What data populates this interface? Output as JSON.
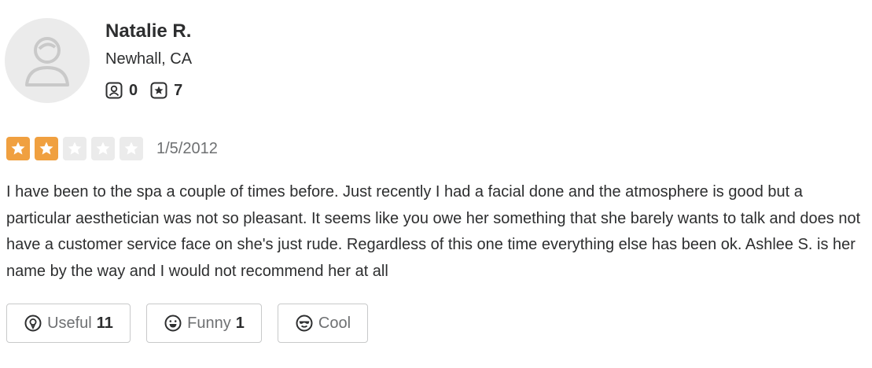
{
  "user": {
    "name": "Natalie R.",
    "location": "Newhall, CA",
    "friends_count": "0",
    "reviews_count": "7",
    "avatar_icon": "default-user-avatar-icon"
  },
  "review": {
    "rating": 2,
    "max_rating": 5,
    "date": "1/5/2012",
    "text": "I have been to the spa a couple of times before. Just recently I had a facial done and the atmosphere is good but a particular aesthetician was not so pleasant. It seems like you owe her something that she barely wants to talk and does not have a customer service face on she's just rude. Regardless of this one time everything else has been ok. Ashlee S. is her name by the way and I would not recommend her at all"
  },
  "actions": {
    "useful_label": "Useful",
    "useful_count": "11",
    "funny_label": "Funny",
    "funny_count": "1",
    "cool_label": "Cool"
  },
  "colors": {
    "star_on": "#f0a040",
    "star_off": "#ebebeb",
    "text": "#2d2e2f",
    "muted": "#6e7072",
    "border": "#c8c9ca"
  }
}
